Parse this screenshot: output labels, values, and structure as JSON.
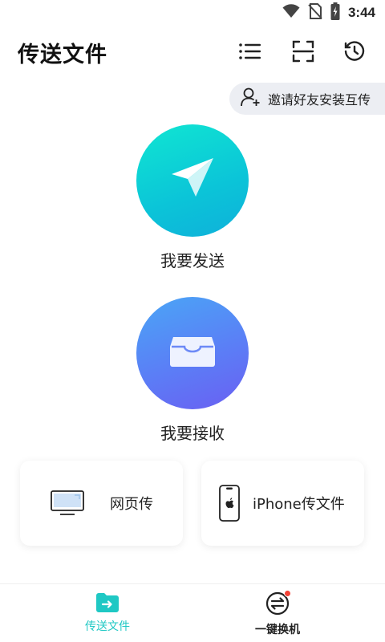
{
  "status_bar": {
    "time": "3:44"
  },
  "header": {
    "title": "传送文件"
  },
  "invite": {
    "label": "邀请好友安装互传"
  },
  "actions": {
    "send": {
      "label": "我要发送"
    },
    "receive": {
      "label": "我要接收"
    }
  },
  "cards": {
    "web": {
      "label": "网页传"
    },
    "iphone": {
      "label": "iPhone传文件"
    }
  },
  "bottom_nav": {
    "items": [
      {
        "label": "传送文件"
      },
      {
        "label": "一键换机"
      }
    ]
  },
  "colors": {
    "accent": "#1fc8c4",
    "badge": "#f44336"
  },
  "icons": [
    "wifi-icon",
    "no-sim-icon",
    "battery-icon",
    "list-icon",
    "scan-icon",
    "history-icon",
    "add-user-icon",
    "paper-plane-icon",
    "inbox-icon",
    "monitor-icon",
    "iphone-icon",
    "folder-transfer-icon",
    "swap-icon"
  ]
}
